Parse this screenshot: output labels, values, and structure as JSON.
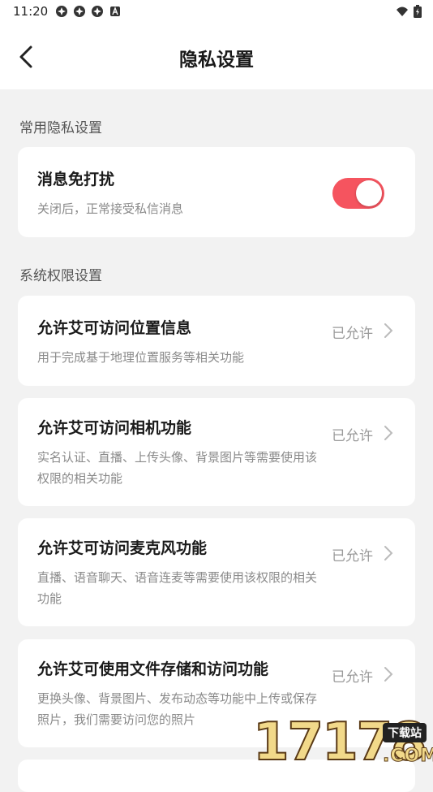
{
  "status_bar": {
    "time": "11:20",
    "icons": [
      "notification-icon",
      "notification-icon",
      "notification-icon",
      "a-icon"
    ],
    "right_icons": [
      "wifi-icon",
      "battery-icon"
    ]
  },
  "header": {
    "back_icon": "back-arrow-icon",
    "title": "隐私设置"
  },
  "sections": {
    "common": {
      "title": "常用隐私设置"
    },
    "system": {
      "title": "系统权限设置"
    }
  },
  "dnd": {
    "title": "消息免打扰",
    "desc": "关闭后，正常接受私信消息",
    "toggle_on": true,
    "accent": "#f5545f"
  },
  "permissions": [
    {
      "title": "允许艾可访问位置信息",
      "desc": "用于完成基于地理位置服务等相关功能",
      "status": "已允许"
    },
    {
      "title": "允许艾可访问相机功能",
      "desc": "实名认证、直播、上传头像、背景图片等需要使用该权限的相关功能",
      "status": "已允许"
    },
    {
      "title": "允许艾可访问麦克风功能",
      "desc": "直播、语音聊天、语音连麦等需要使用该权限的相关功能",
      "status": "已允许"
    },
    {
      "title": "允许艾可使用文件存储和访问功能",
      "desc": "更换头像、背景图片、发布动态等功能中上传或保存照片，我们需要访问您的照片",
      "status": "已允许"
    }
  ],
  "watermark": {
    "number": "17178",
    "tag": "下载站",
    "domain": ".COM"
  }
}
